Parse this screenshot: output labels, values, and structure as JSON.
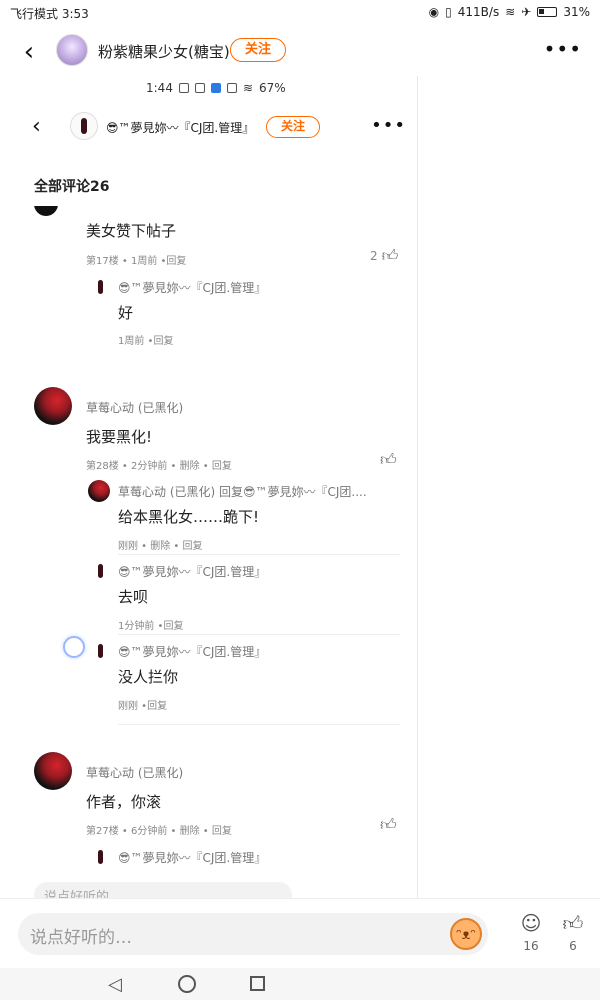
{
  "status_bar": {
    "left": "飞行模式 3:53",
    "network_speed": "411B/s",
    "battery": "31%"
  },
  "header": {
    "title": "粉紫糖果少女(糖宝)",
    "follow_label": "关注"
  },
  "inner_status": {
    "time": "1:44",
    "battery": "67%"
  },
  "inner_header": {
    "title": "😎™夢見妳〰『CJ团.管理』",
    "follow_label": "关注"
  },
  "comments_header": "全部评论26",
  "comments": [
    {
      "text": "美女赞下帖子",
      "meta": "第17楼 • 1周前 •回复",
      "likes": "2",
      "replies": [
        {
          "user": "😎™夢見妳〰『CJ团.管理』",
          "text": "好",
          "meta": "1周前 •回复"
        }
      ]
    },
    {
      "user": "草莓心动 (已黑化)",
      "text": "我要黑化!",
      "meta": "第28楼 • 2分钟前 • 删除 • 回复",
      "replies": [
        {
          "user": "草莓心动 (已黑化) 回复😎™夢見妳〰『CJ团....",
          "text": "给本黑化女……跪下!",
          "meta": "刚刚 • 删除 • 回复"
        },
        {
          "user": "😎™夢見妳〰『CJ团.管理』",
          "text": "去呗",
          "meta": "1分钟前 •回复"
        },
        {
          "user": "😎™夢見妳〰『CJ团.管理』",
          "text": "没人拦你",
          "meta": "刚刚 •回复"
        }
      ]
    },
    {
      "user": "草莓心动 (已黑化)",
      "text": "作者，你滚",
      "meta": "第27楼 • 6分钟前 • 删除 • 回复",
      "replies": [
        {
          "user": "😎™夢見妳〰『CJ团.管理』"
        }
      ]
    }
  ],
  "inner_input_placeholder": "说点好听的",
  "bottom": {
    "input_placeholder": "说点好听的…",
    "comment_count": "16",
    "like_count": "6"
  },
  "colors": {
    "accent": "#ff6a00"
  }
}
